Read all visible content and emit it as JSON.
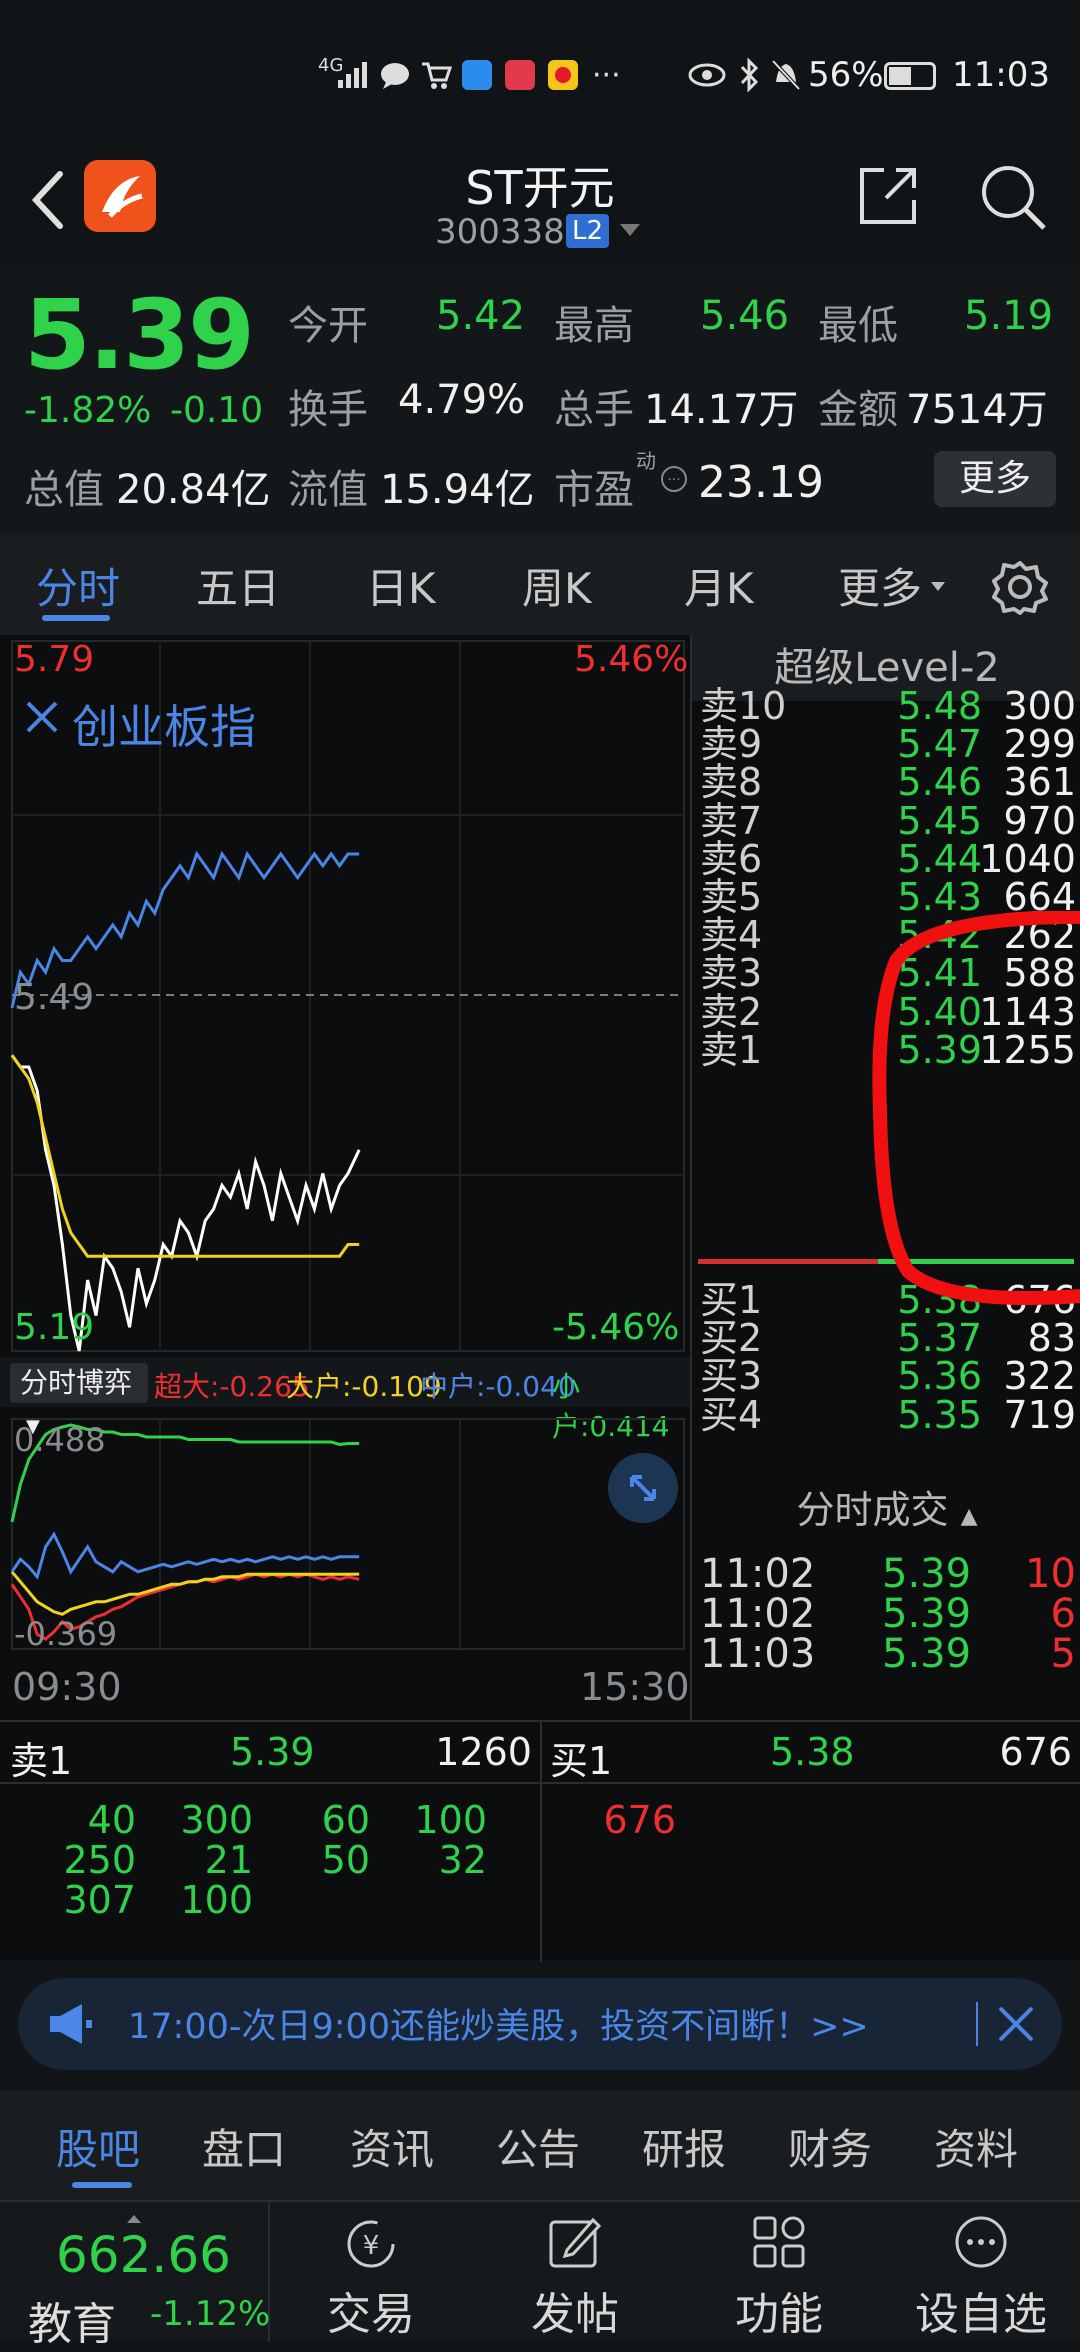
{
  "status": {
    "network": "4G",
    "battery": "56%",
    "time": "11:03"
  },
  "header": {
    "title": "ST开元",
    "code": "300338",
    "level_badge": "L2"
  },
  "quote": {
    "price": "5.39",
    "change_pct": "-1.82%",
    "change": "-0.10",
    "open_label": "今开",
    "open": "5.42",
    "high_label": "最高",
    "high": "5.46",
    "low_label": "最低",
    "low": "5.19",
    "turnover_label": "换手",
    "turnover": "4.79%",
    "volume_label": "总手",
    "volume": "14.17万",
    "amount_label": "金额",
    "amount": "7514万",
    "total_mv_label": "总值",
    "total_mv": "20.84亿",
    "float_mv_label": "流值",
    "float_mv": "15.94亿",
    "pe_label": "市盈",
    "pe_sup": "动",
    "pe": "23.19",
    "more_button": "更多"
  },
  "chart_tabs": {
    "items": [
      "分时",
      "五日",
      "日K",
      "周K",
      "月K",
      "更多"
    ],
    "active": 0
  },
  "chart": {
    "top_price": "5.79",
    "top_pct": "5.46%",
    "mid_price": "5.49",
    "bottom_price": "5.19",
    "bottom_pct": "-5.46%",
    "overlay_label": "创业板指",
    "flow_dropdown": "分时博弈",
    "flow_super": "超大:-0.265",
    "flow_large": "大户:-0.109",
    "flow_mid": "中户:-0.040",
    "flow_small": "小户:0.414",
    "sub_top": "0.488",
    "sub_bottom": "-0.369",
    "time_start": "09:30",
    "time_end": "15:30",
    "colors": {
      "price": "#ffffff",
      "avg": "#f1d21f",
      "index": "#4b86e6"
    }
  },
  "chart_data": [
    {
      "type": "line",
      "title": "",
      "x": [
        0,
        3,
        6,
        9,
        12,
        15,
        18,
        21,
        24,
        27,
        30,
        33,
        36,
        39,
        42,
        45,
        48,
        51,
        54,
        57,
        60,
        63,
        66,
        69,
        72,
        75,
        78,
        81,
        84,
        87,
        90,
        93,
        96,
        99,
        102,
        105,
        108,
        111,
        114,
        117,
        120,
        124
      ],
      "ylim": [
        5.19,
        5.79
      ],
      "series": [
        {
          "name": "",
          "values": [
            5.44,
            5.43,
            5.43,
            5.41,
            5.36,
            5.33,
            5.28,
            5.22,
            5.19,
            5.25,
            5.22,
            5.27,
            5.26,
            5.24,
            5.21,
            5.26,
            5.23,
            5.25,
            5.28,
            5.27,
            5.3,
            5.29,
            5.27,
            5.3,
            5.31,
            5.33,
            5.32,
            5.34,
            5.31,
            5.35,
            5.33,
            5.3,
            5.34,
            5.32,
            5.3,
            5.33,
            5.31,
            5.34,
            5.31,
            5.33,
            5.34,
            5.36
          ]
        },
        {
          "name": "",
          "values": [
            5.44,
            5.43,
            5.42,
            5.4,
            5.37,
            5.34,
            5.31,
            5.29,
            5.28,
            5.27,
            5.27,
            5.27,
            5.27,
            5.27,
            5.27,
            5.27,
            5.27,
            5.27,
            5.27,
            5.27,
            5.27,
            5.27,
            5.27,
            5.27,
            5.27,
            5.27,
            5.27,
            5.27,
            5.27,
            5.27,
            5.27,
            5.27,
            5.27,
            5.27,
            5.27,
            5.27,
            5.27,
            5.27,
            5.27,
            5.27,
            5.28,
            5.28
          ]
        },
        {
          "name": "创业板指",
          "values": [
            5.48,
            5.51,
            5.5,
            5.52,
            5.51,
            5.53,
            5.52,
            5.52,
            5.53,
            5.54,
            5.53,
            5.54,
            5.55,
            5.54,
            5.56,
            5.55,
            5.57,
            5.56,
            5.58,
            5.59,
            5.6,
            5.59,
            5.61,
            5.6,
            5.59,
            5.61,
            5.6,
            5.59,
            5.61,
            5.6,
            5.59,
            5.6,
            5.61,
            5.6,
            5.59,
            5.6,
            5.61,
            5.6,
            5.61,
            5.6,
            5.61,
            5.61
          ]
        }
      ]
    },
    {
      "type": "line",
      "title": "",
      "x": [
        0,
        3,
        6,
        9,
        12,
        15,
        18,
        21,
        24,
        27,
        30,
        33,
        36,
        39,
        42,
        45,
        48,
        51,
        54,
        57,
        60,
        63,
        66,
        69,
        72,
        75,
        78,
        81,
        84,
        87,
        90,
        93,
        96,
        99,
        102,
        105,
        108,
        111,
        114,
        117,
        120,
        124
      ],
      "ylim": [
        -0.369,
        0.488
      ],
      "series": [
        {
          "name": "超大",
          "values": [
            -0.15,
            -0.2,
            -0.25,
            -0.35,
            -0.369,
            -0.34,
            -0.3,
            -0.33,
            -0.32,
            -0.3,
            -0.28,
            -0.27,
            -0.25,
            -0.24,
            -0.22,
            -0.2,
            -0.19,
            -0.18,
            -0.17,
            -0.16,
            -0.15,
            -0.14,
            -0.14,
            -0.13,
            -0.14,
            -0.13,
            -0.12,
            -0.13,
            -0.12,
            -0.11,
            -0.12,
            -0.11,
            -0.12,
            -0.11,
            -0.12,
            -0.11,
            -0.12,
            -0.13,
            -0.12,
            -0.13,
            -0.12,
            -0.13
          ]
        },
        {
          "name": "大户",
          "values": [
            -0.1,
            -0.14,
            -0.18,
            -0.22,
            -0.24,
            -0.26,
            -0.27,
            -0.25,
            -0.24,
            -0.23,
            -0.22,
            -0.22,
            -0.21,
            -0.2,
            -0.19,
            -0.19,
            -0.18,
            -0.17,
            -0.16,
            -0.15,
            -0.15,
            -0.14,
            -0.14,
            -0.13,
            -0.13,
            -0.12,
            -0.12,
            -0.12,
            -0.11,
            -0.11,
            -0.11,
            -0.11,
            -0.11,
            -0.11,
            -0.11,
            -0.11,
            -0.11,
            -0.11,
            -0.11,
            -0.11,
            -0.11,
            -0.109
          ]
        },
        {
          "name": "中户",
          "values": [
            -0.1,
            -0.05,
            -0.08,
            -0.12,
            0.0,
            0.05,
            -0.02,
            -0.1,
            -0.05,
            0.0,
            -0.06,
            -0.08,
            -0.1,
            -0.06,
            -0.08,
            -0.1,
            -0.09,
            -0.08,
            -0.07,
            -0.08,
            -0.07,
            -0.06,
            -0.07,
            -0.06,
            -0.05,
            -0.06,
            -0.05,
            -0.06,
            -0.05,
            -0.06,
            -0.05,
            -0.04,
            -0.05,
            -0.04,
            -0.05,
            -0.04,
            -0.05,
            -0.04,
            -0.05,
            -0.04,
            -0.04,
            -0.04
          ]
        },
        {
          "name": "小户",
          "values": [
            0.1,
            0.25,
            0.35,
            0.4,
            0.45,
            0.47,
            0.48,
            0.488,
            0.48,
            0.47,
            0.47,
            0.46,
            0.46,
            0.45,
            0.45,
            0.45,
            0.44,
            0.44,
            0.44,
            0.44,
            0.44,
            0.43,
            0.43,
            0.43,
            0.43,
            0.43,
            0.43,
            0.42,
            0.42,
            0.42,
            0.42,
            0.42,
            0.42,
            0.42,
            0.42,
            0.42,
            0.42,
            0.42,
            0.42,
            0.41,
            0.414,
            0.414
          ]
        }
      ]
    }
  ],
  "orderbook": {
    "title": "超级Level-2",
    "asks": [
      {
        "label": "卖10",
        "price": "5.48",
        "vol": "300"
      },
      {
        "label": "卖9",
        "price": "5.47",
        "vol": "299"
      },
      {
        "label": "卖8",
        "price": "5.46",
        "vol": "361"
      },
      {
        "label": "卖7",
        "price": "5.45",
        "vol": "970"
      },
      {
        "label": "卖6",
        "price": "5.44",
        "vol": "1040"
      },
      {
        "label": "卖5",
        "price": "5.43",
        "vol": "664"
      },
      {
        "label": "卖4",
        "price": "5.42",
        "vol": "262"
      },
      {
        "label": "卖3",
        "price": "5.41",
        "vol": "588"
      },
      {
        "label": "卖2",
        "price": "5.40",
        "vol": "1143"
      },
      {
        "label": "卖1",
        "price": "5.39",
        "vol": "1255"
      }
    ],
    "bids": [
      {
        "label": "买1",
        "price": "5.38",
        "vol": "676"
      },
      {
        "label": "买2",
        "price": "5.37",
        "vol": "83"
      },
      {
        "label": "买3",
        "price": "5.36",
        "vol": "322"
      },
      {
        "label": "买4",
        "price": "5.35",
        "vol": "719"
      }
    ]
  },
  "ticks": {
    "title": "分时成交",
    "rows": [
      {
        "time": "11:02",
        "price": "5.39",
        "vol": "10"
      },
      {
        "time": "11:02",
        "price": "5.39",
        "vol": "6"
      },
      {
        "time": "11:03",
        "price": "5.39",
        "vol": "5"
      }
    ]
  },
  "queues": {
    "ask_label": "卖1",
    "ask_price": "5.39",
    "ask_total": "1260",
    "ask_orders": [
      "40",
      "300",
      "60",
      "100",
      "250",
      "21",
      "50",
      "32",
      "307",
      "100"
    ],
    "bid_label": "买1",
    "bid_price": "5.38",
    "bid_total": "676",
    "bid_orders": [
      "676"
    ]
  },
  "banner": {
    "text": "17:00-次日9:00还能炒美股，投资不间断！>>"
  },
  "bottom_tabs": {
    "items": [
      "股吧",
      "盘口",
      "资讯",
      "公告",
      "研报",
      "财务",
      "资料"
    ],
    "active": 0
  },
  "bottom_nav": {
    "index_value": "662.66",
    "index_name": "教育",
    "index_change": "-1.12%",
    "items": [
      {
        "label": "交易",
        "icon": "trade-icon"
      },
      {
        "label": "发帖",
        "icon": "post-icon"
      },
      {
        "label": "功能",
        "icon": "functions-icon"
      },
      {
        "label": "设自选",
        "icon": "more-icon"
      }
    ]
  }
}
